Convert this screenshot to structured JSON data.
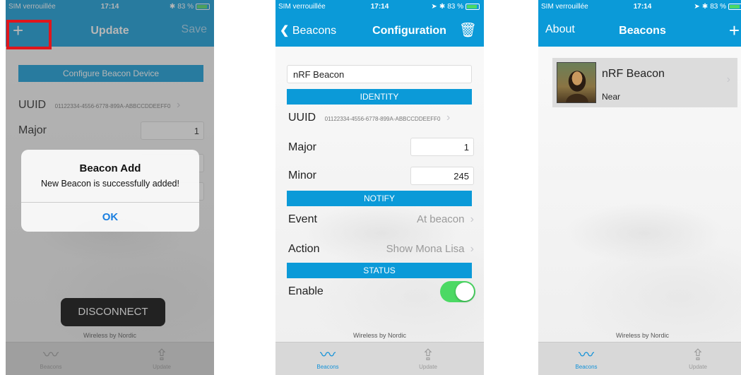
{
  "status": {
    "carrier": "SIM verrouillée",
    "time": "17:14",
    "battery": "83 %"
  },
  "screen1": {
    "nav": {
      "left": "+",
      "title": "Update",
      "right": "Save"
    },
    "configure_button": "Configure Beacon Device",
    "uuid_label": "UUID",
    "uuid_value": "01122334-4556-6778-899A-ABBCCDDEEFF0",
    "major_label": "Major",
    "major_value": "1",
    "alert": {
      "title": "Beacon Add",
      "message": "New Beacon is successfully added!",
      "button": "OK"
    },
    "disconnect": "DISCONNECT",
    "footer": "Wireless by Nordic",
    "tabs": [
      "Beacons",
      "Update"
    ]
  },
  "screen2": {
    "nav": {
      "back": "Beacons",
      "title": "Configuration"
    },
    "name_value": "nRF Beacon",
    "identity_header": "IDENTITY",
    "uuid_label": "UUID",
    "uuid_value": "01122334-4556-6778-899A-ABBCCDDEEFF0",
    "major_label": "Major",
    "major_value": "1",
    "minor_label": "Minor",
    "minor_value": "245",
    "notify_header": "NOTIFY",
    "event_label": "Event",
    "event_value": "At beacon",
    "action_label": "Action",
    "action_value": "Show Mona Lisa",
    "status_header": "STATUS",
    "enable_label": "Enable",
    "enable_on": true,
    "footer": "Wireless by Nordic",
    "tabs": [
      "Beacons",
      "Update"
    ]
  },
  "screen3": {
    "nav": {
      "left": "About",
      "title": "Beacons",
      "right": "+"
    },
    "beacon": {
      "name": "nRF Beacon",
      "proximity": "Near"
    },
    "footer": "Wireless by Nordic",
    "tabs": [
      "Beacons",
      "Update"
    ]
  },
  "colors": {
    "accent": "#0b9ad8",
    "highlight": "#e0161c",
    "toggle": "#4cd964"
  },
  "icons": [
    "plus-icon",
    "back-chevron-icon",
    "trash-icon",
    "beacons-tab-icon",
    "update-tab-icon",
    "chevron-right-icon",
    "mona-lisa-thumbnail"
  ]
}
